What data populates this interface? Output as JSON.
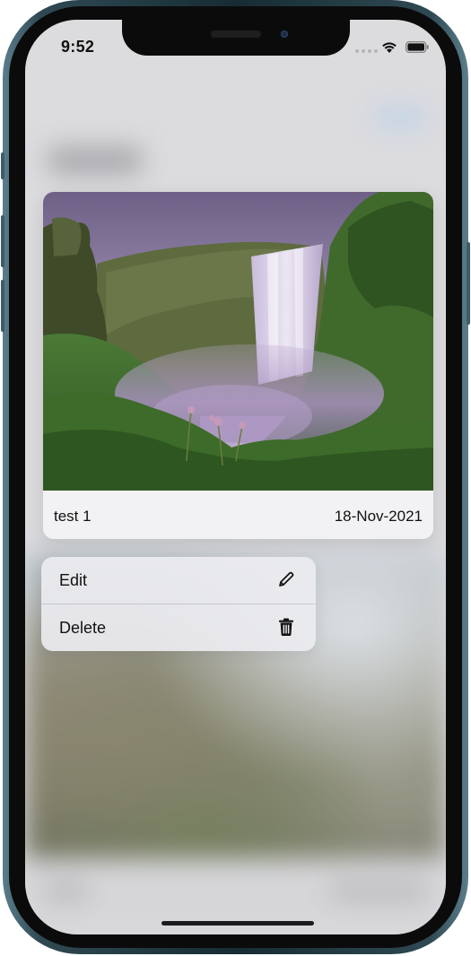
{
  "status_bar": {
    "time": "9:52",
    "wifi_icon": "wifi-icon",
    "battery_icon": "battery-icon"
  },
  "preview_card": {
    "photo_description": "waterfall-photo",
    "title": "test 1",
    "date": "18-Nov-2021"
  },
  "context_menu": {
    "items": [
      {
        "label": "Edit",
        "icon": "pencil-icon"
      },
      {
        "label": "Delete",
        "icon": "trash-icon"
      }
    ]
  },
  "colors": {
    "accent_blurred": "#a9c7e7",
    "menu_background": "#ececf0",
    "card_footer": "#f2f2f4"
  }
}
